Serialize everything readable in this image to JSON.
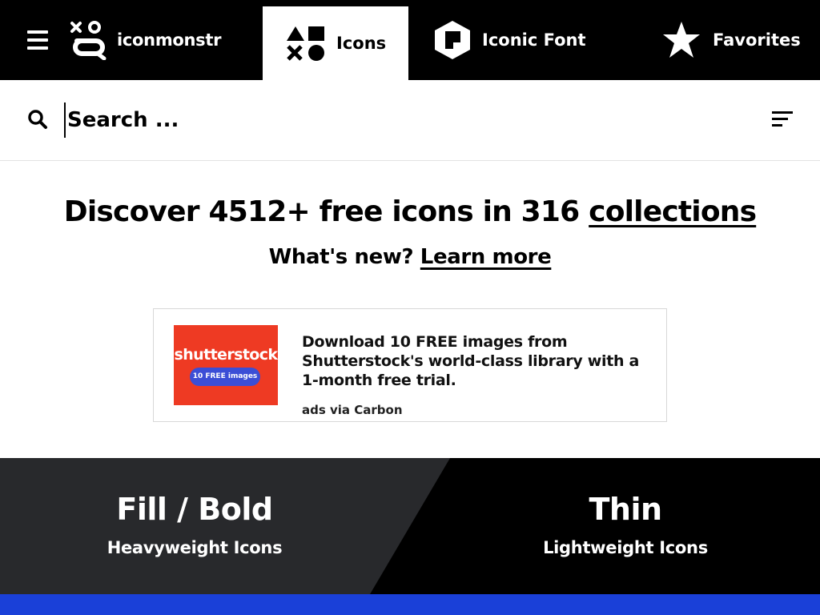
{
  "nav": {
    "brand": "iconmonstr",
    "tabs": [
      {
        "label": "Icons",
        "icon": "shapes-icon",
        "active": true
      },
      {
        "label": "Iconic Font",
        "icon": "font-hex-icon",
        "active": false
      },
      {
        "label": "Favorites",
        "icon": "star-icon",
        "active": false
      }
    ]
  },
  "search": {
    "placeholder": "Search ..."
  },
  "hero": {
    "headline_prefix": "Discover 4512+ free icons in 316 ",
    "headline_link": "collections",
    "sub_prefix": "What's new? ",
    "sub_link": "Learn more"
  },
  "ad": {
    "logo": "shutterstock",
    "pill": "10 FREE images",
    "text": "Download 10 FREE images from Shutterstock's world-class library with a 1-month free trial.",
    "via": "ads via Carbon"
  },
  "cards": [
    {
      "title": "Fill / Bold",
      "sub": "Heavyweight Icons"
    },
    {
      "title": "Thin",
      "sub": "Lightweight Icons"
    }
  ],
  "colors": {
    "nav_bg": "#000000",
    "card_fill_bg": "#28292c",
    "accent_blue": "#1a40d8",
    "ad_red": "#ee3a23"
  }
}
